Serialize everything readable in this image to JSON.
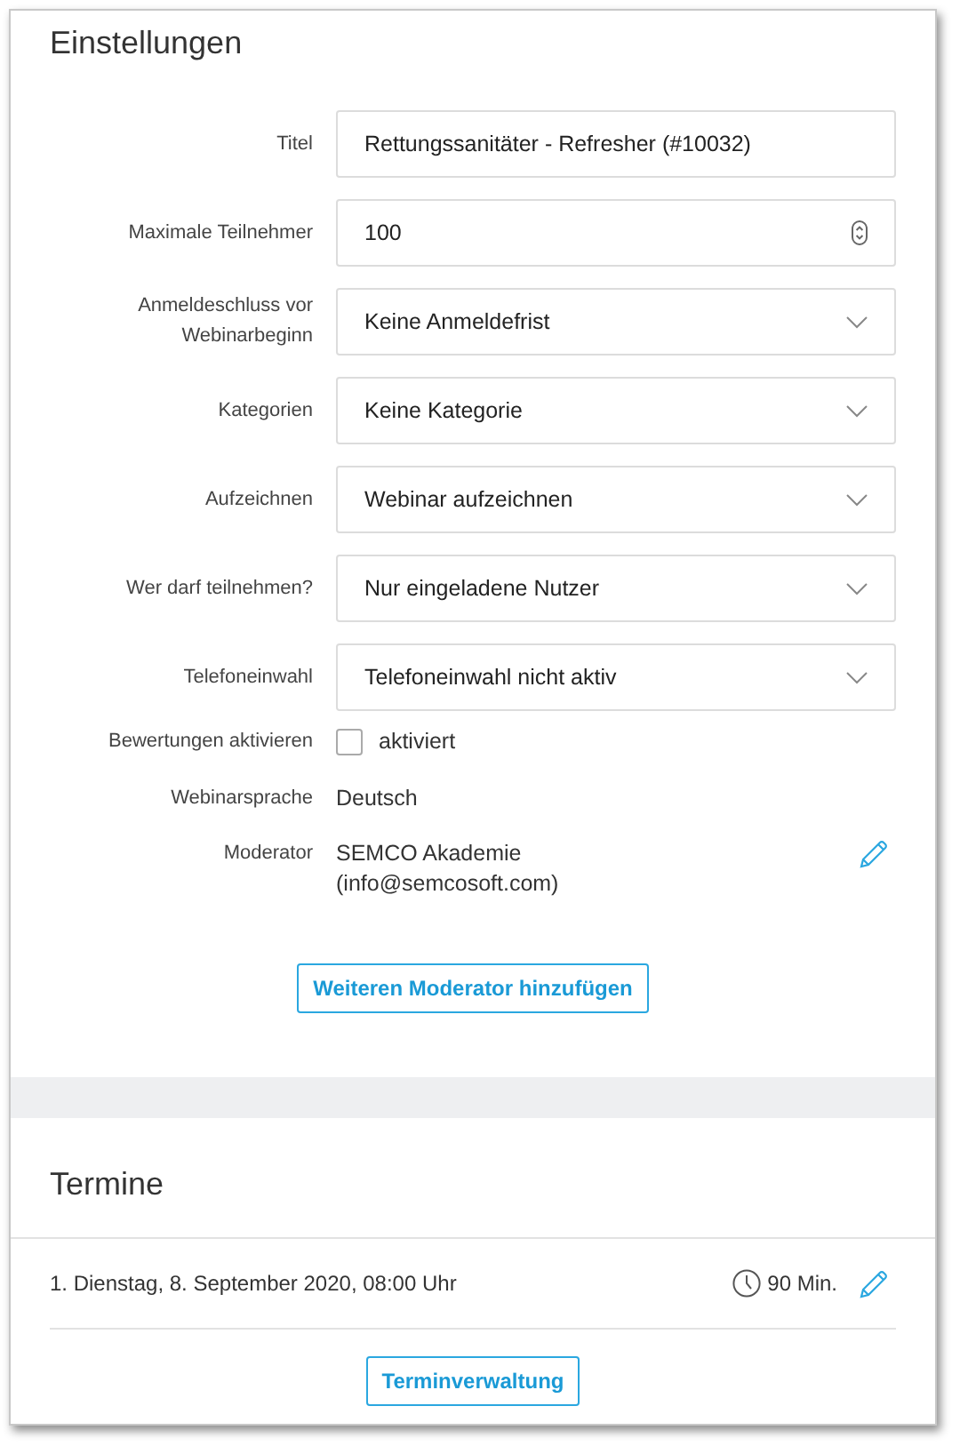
{
  "settings": {
    "title": "Einstellungen",
    "fields": [
      {
        "kind": "text",
        "label": "Titel",
        "value": "Rettungssanitäter - Refresher (#10032)"
      },
      {
        "kind": "number",
        "label": "Maximale Teilnehmer",
        "value": "100"
      },
      {
        "kind": "select",
        "label": "Anmeldeschluss vor Webinarbeginn",
        "value": "Keine Anmeldefrist"
      },
      {
        "kind": "select",
        "label": "Kategorien",
        "value": "Keine Kategorie"
      },
      {
        "kind": "select",
        "label": "Aufzeichnen",
        "value": "Webinar aufzeichnen"
      },
      {
        "kind": "select",
        "label": "Wer darf teilnehmen?",
        "value": "Nur eingeladene Nutzer"
      },
      {
        "kind": "select",
        "label": "Telefoneinwahl",
        "value": "Telefoneinwahl nicht aktiv"
      },
      {
        "kind": "checkbox",
        "label": "Bewertungen aktivieren",
        "value": "aktiviert",
        "checked": false
      },
      {
        "kind": "static",
        "label": "Webinarsprache",
        "value": "Deutsch"
      },
      {
        "kind": "moderator",
        "label": "Moderator",
        "value": "SEMCO Akademie",
        "email": "(info@semcosoft.com)"
      }
    ],
    "add_button": "Weiteren Moderator hinzufügen"
  },
  "appointments": {
    "title": "Termine",
    "items": [
      {
        "text": "1. Dienstag, 8. September 2020, 08:00 Uhr",
        "duration": "90 Min."
      }
    ],
    "manage_button": "Terminverwaltung"
  }
}
